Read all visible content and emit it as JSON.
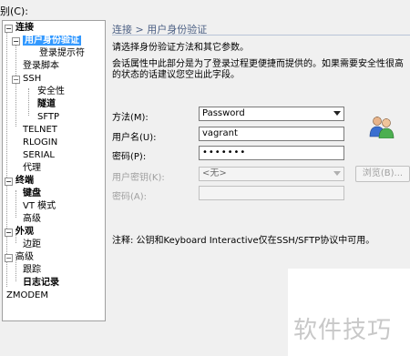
{
  "category_label": "别(C):",
  "tree": {
    "items": [
      {
        "label": "连接",
        "bold": true,
        "expander": "−"
      },
      {
        "label": "用户身份验证",
        "bold": true,
        "expander": "−",
        "selected": true
      },
      {
        "label": "登录提示符"
      },
      {
        "label": "登录脚本"
      },
      {
        "label": "SSH",
        "expander": "−"
      },
      {
        "label": "安全性"
      },
      {
        "label": "隧道",
        "bold": true
      },
      {
        "label": "SFTP"
      },
      {
        "label": "TELNET"
      },
      {
        "label": "RLOGIN"
      },
      {
        "label": "SERIAL"
      },
      {
        "label": "代理"
      },
      {
        "label": "终端",
        "bold": true,
        "expander": "−"
      },
      {
        "label": "键盘",
        "bold": true
      },
      {
        "label": "VT 模式"
      },
      {
        "label": "高级"
      },
      {
        "label": "外观",
        "bold": true,
        "expander": "−"
      },
      {
        "label": "边距"
      },
      {
        "label": "高级",
        "expander": "−"
      },
      {
        "label": "跟踪"
      },
      {
        "label": "日志记录",
        "bold": true
      },
      {
        "label": "ZMODEM"
      }
    ]
  },
  "panel": {
    "title": "连接 > 用户身份验证",
    "desc1": "请选择身份验证方法和其它参数。",
    "desc2": "会话属性中此部分是为了登录过程更便捷而提供的。如果需要安全性很高",
    "desc3": "的状态的话建议您空出此字段。",
    "method_label": "方法(M):",
    "method_value": "Password",
    "username_label": "用户名(U):",
    "username_value": "vagrant",
    "password_label": "密码(P):",
    "password_value": "•••••••",
    "userkey_label": "用户密钥(K):",
    "userkey_value": "<无>",
    "browse_label": "浏览(B)...",
    "passphrase_label": "密码(A):",
    "note": "注释: 公钥和Keyboard Interactive仅在SSH/SFTP协议中可用。"
  },
  "watermark": "软件技巧",
  "colors": {
    "selection": "#3399ff",
    "title": "#4d6185"
  }
}
